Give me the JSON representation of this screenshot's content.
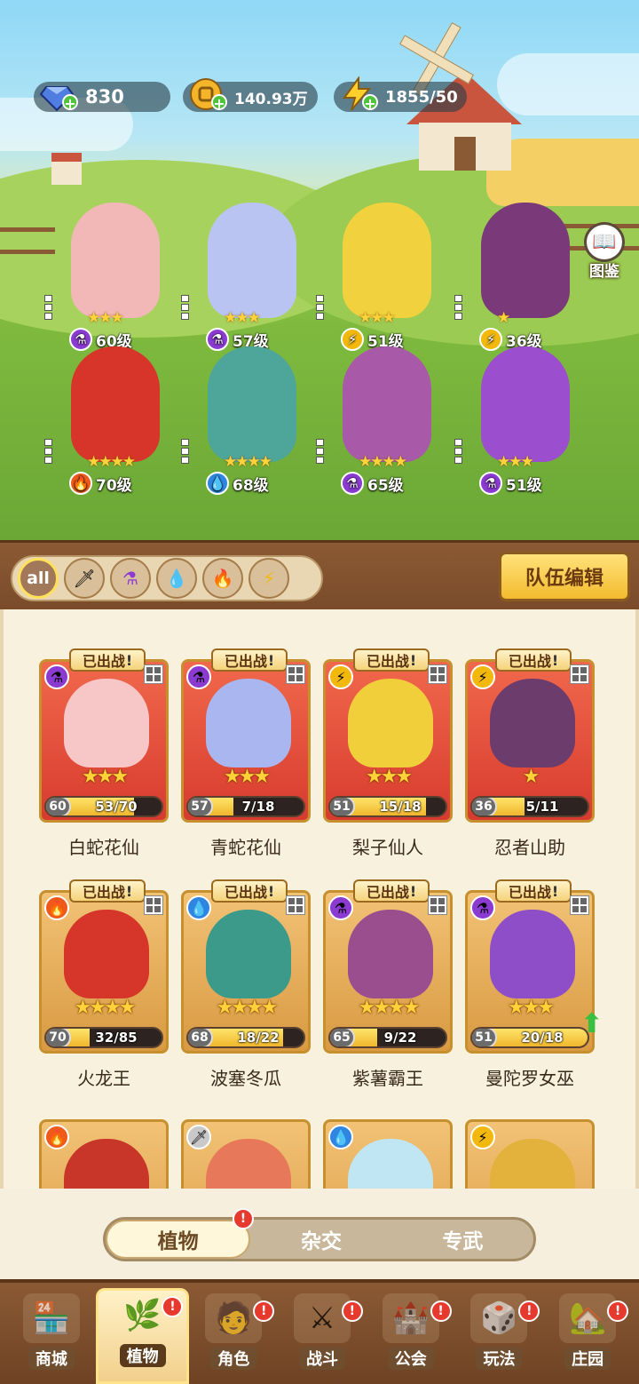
{
  "resources": {
    "gems": "830",
    "coins": "140.93万",
    "energy": "1855/50"
  },
  "codex_label": "图鉴",
  "field_heroes": [
    {
      "level": "60级",
      "stars": "★★★",
      "element": "purple"
    },
    {
      "level": "57级",
      "stars": "★★★",
      "element": "purple"
    },
    {
      "level": "51级",
      "stars": "★★★",
      "element": "lightning"
    },
    {
      "level": "36级",
      "stars": "★",
      "element": "lightning"
    },
    {
      "level": "70级",
      "stars": "★★★★",
      "element": "fire"
    },
    {
      "level": "68级",
      "stars": "★★★★",
      "element": "water"
    },
    {
      "level": "65级",
      "stars": "★★★★",
      "element": "purple"
    },
    {
      "level": "51级",
      "stars": "★★★",
      "element": "purple"
    }
  ],
  "filters": [
    "all",
    "sword",
    "potion",
    "water",
    "fire",
    "lightning"
  ],
  "team_edit_label": "队伍编辑",
  "deployed_label": "已出战",
  "cards": [
    {
      "name": "白蛇花仙",
      "level": "60",
      "progress": "53/70",
      "fill": 0.76,
      "stars": "★★★",
      "frame": "red",
      "element": "purple"
    },
    {
      "name": "青蛇花仙",
      "level": "57",
      "progress": "7/18",
      "fill": 0.39,
      "stars": "★★★",
      "frame": "red",
      "element": "purple"
    },
    {
      "name": "梨子仙人",
      "level": "51",
      "progress": "15/18",
      "fill": 0.83,
      "stars": "★★★",
      "frame": "red",
      "element": "lightning"
    },
    {
      "name": "忍者山助",
      "level": "36",
      "progress": "5/11",
      "fill": 0.45,
      "stars": "★",
      "frame": "red",
      "element": "lightning"
    },
    {
      "name": "火龙王",
      "level": "70",
      "progress": "32/85",
      "fill": 0.38,
      "stars": "★★★★",
      "frame": "gold",
      "element": "fire"
    },
    {
      "name": "波塞冬瓜",
      "level": "68",
      "progress": "18/22",
      "fill": 0.82,
      "stars": "★★★★",
      "frame": "gold",
      "element": "water"
    },
    {
      "name": "紫薯霸王",
      "level": "65",
      "progress": "9/22",
      "fill": 0.41,
      "stars": "★★★★",
      "frame": "gold",
      "element": "purple"
    },
    {
      "name": "曼陀罗女巫",
      "level": "51",
      "progress": "20/18",
      "fill": 1.0,
      "stars": "★★★",
      "frame": "gold",
      "element": "purple"
    }
  ],
  "sub_tabs": [
    "植物",
    "杂交",
    "专武"
  ],
  "nav": [
    "商城",
    "植物",
    "角色",
    "战斗",
    "公会",
    "玩法",
    "庄园"
  ],
  "colors": {
    "accent": "#f3bb2e",
    "brown": "#7a4b2a",
    "alert": "#e63a2f"
  }
}
